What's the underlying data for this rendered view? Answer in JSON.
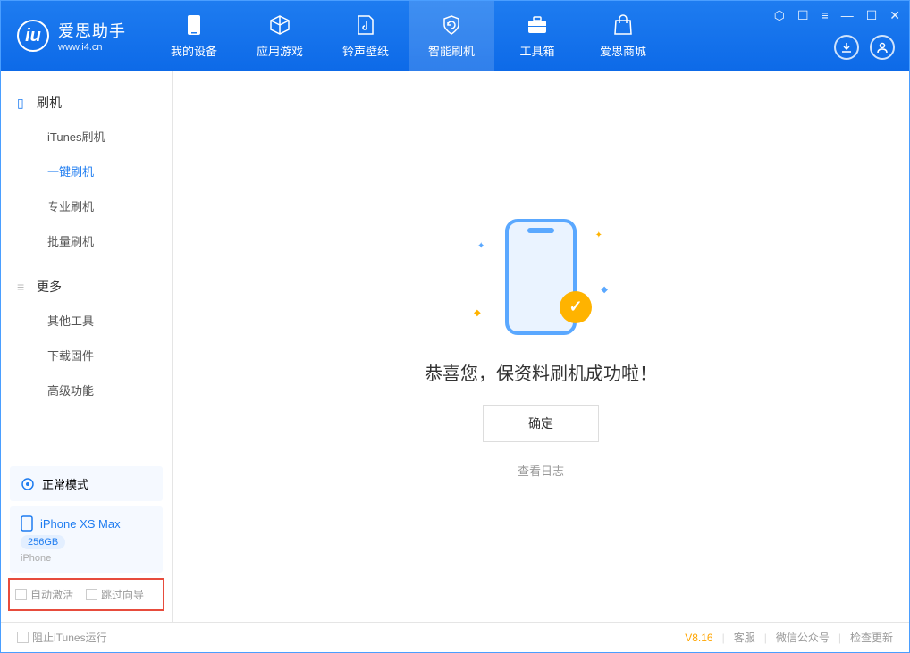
{
  "header": {
    "app_name": "爱思助手",
    "app_url": "www.i4.cn",
    "nav": [
      {
        "label": "我的设备"
      },
      {
        "label": "应用游戏"
      },
      {
        "label": "铃声壁纸"
      },
      {
        "label": "智能刷机"
      },
      {
        "label": "工具箱"
      },
      {
        "label": "爱思商城"
      }
    ]
  },
  "sidebar": {
    "section1": {
      "title": "刷机",
      "items": [
        "iTunes刷机",
        "一键刷机",
        "专业刷机",
        "批量刷机"
      ]
    },
    "section2": {
      "title": "更多",
      "items": [
        "其他工具",
        "下载固件",
        "高级功能"
      ]
    },
    "mode": "正常模式",
    "device": {
      "name": "iPhone XS Max",
      "storage": "256GB",
      "type": "iPhone"
    },
    "checkboxes": {
      "auto_activate": "自动激活",
      "skip_guide": "跳过向导"
    }
  },
  "main": {
    "success_message": "恭喜您，保资料刷机成功啦！",
    "ok_button": "确定",
    "view_log": "查看日志"
  },
  "footer": {
    "block_itunes": "阻止iTunes运行",
    "version": "V8.16",
    "links": [
      "客服",
      "微信公众号",
      "检查更新"
    ]
  }
}
